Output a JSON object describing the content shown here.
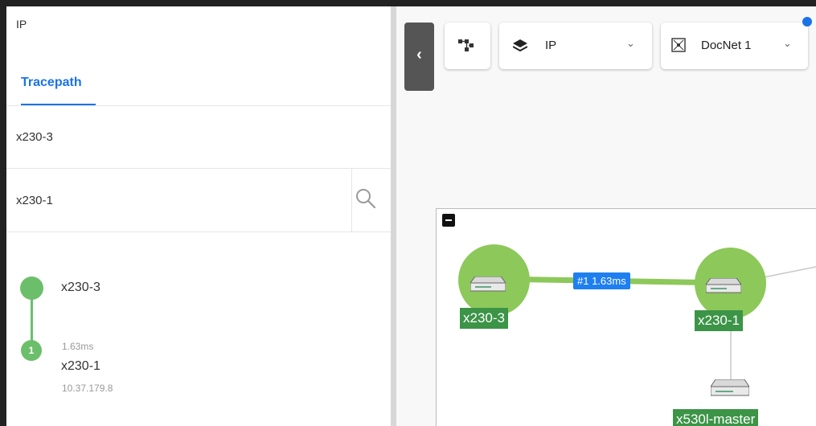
{
  "panel": {
    "title": "IP",
    "tab_label": "Tracepath",
    "source_value": "x230-3",
    "destination_value": "x230-1"
  },
  "hops": [
    {
      "index": "",
      "name": "x230-3",
      "latency": "",
      "ip": ""
    },
    {
      "index": "1",
      "name": "x230-1",
      "latency": "1.63ms",
      "ip": "10.37.179.8"
    }
  ],
  "toolbar": {
    "collapse_glyph": "‹",
    "layer_label": "IP",
    "map_label": "DocNet 1",
    "chevron": "⌄",
    "icons": [
      "topology-icon",
      "layers-icon",
      "map-icon",
      "chevron-down-icon",
      "search-icon"
    ]
  },
  "topology": {
    "nodes": [
      {
        "label": "x230-3"
      },
      {
        "label": "x230-1"
      },
      {
        "label": "x530l-master"
      }
    ],
    "link_label": "#1 1.63ms"
  },
  "colors": {
    "accent": "#1a73e8",
    "path_green": "#6bbf6b",
    "node_halo": "#8dc85a",
    "node_label_bg": "#3c9447",
    "link_label_bg": "#1e7ff0"
  }
}
